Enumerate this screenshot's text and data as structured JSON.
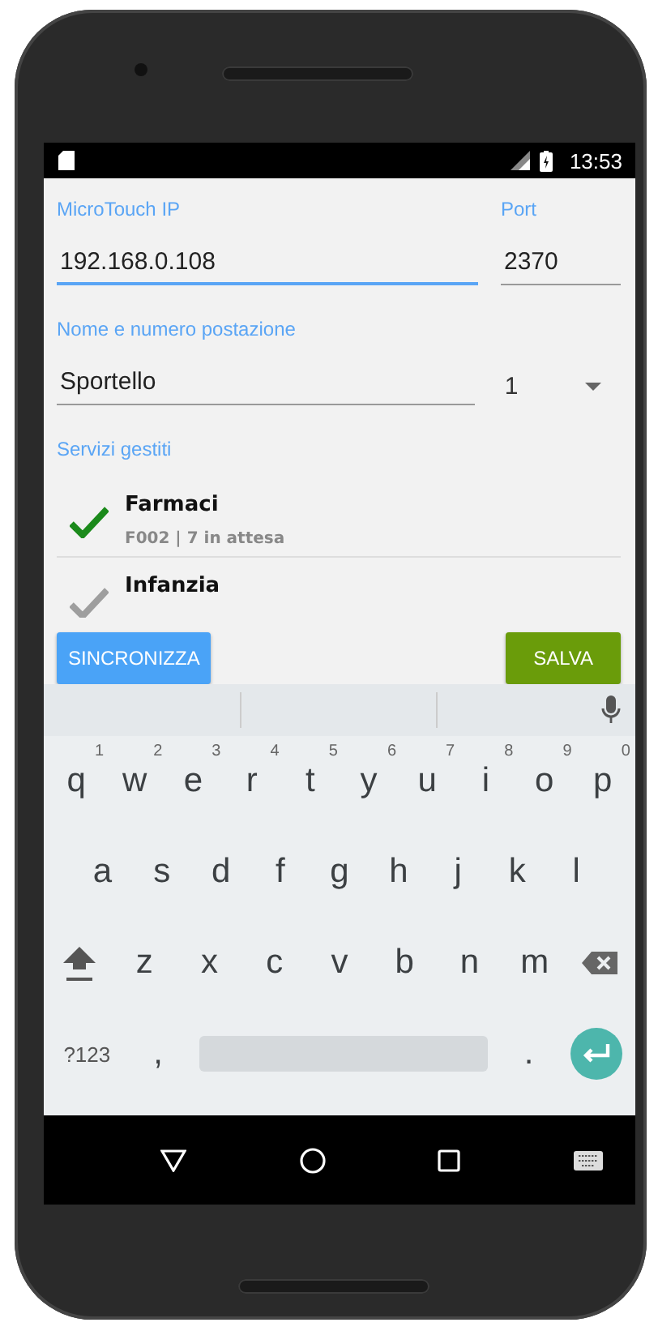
{
  "status_bar": {
    "time": "13:53"
  },
  "fields": {
    "ip_label": "MicroTouch IP",
    "port_label": "Port",
    "ip": "192.168.0.108",
    "port": "2370",
    "station_label": "Nome e numero postazione",
    "station_name": "Sportello",
    "station_number": "1"
  },
  "services_label": "Servizi gestiti",
  "services": [
    {
      "name": "Farmaci",
      "detail": "F002 | 7 in attesa",
      "checked": true
    },
    {
      "name": "Infanzia",
      "checked": false
    }
  ],
  "buttons": {
    "sync": "SINCRONIZZA",
    "save": "SALVA"
  },
  "keyboard": {
    "rows": [
      [
        {
          "label": "q",
          "hint": "1"
        },
        {
          "label": "w",
          "hint": "2"
        },
        {
          "label": "e",
          "hint": "3"
        },
        {
          "label": "r",
          "hint": "4"
        },
        {
          "label": "t",
          "hint": "5"
        },
        {
          "label": "y",
          "hint": "6"
        },
        {
          "label": "u",
          "hint": "7"
        },
        {
          "label": "i",
          "hint": "8"
        },
        {
          "label": "o",
          "hint": "9"
        },
        {
          "label": "p",
          "hint": "0"
        }
      ],
      [
        {
          "label": "a"
        },
        {
          "label": "s"
        },
        {
          "label": "d"
        },
        {
          "label": "f"
        },
        {
          "label": "g"
        },
        {
          "label": "h"
        },
        {
          "label": "j"
        },
        {
          "label": "k"
        },
        {
          "label": "l"
        }
      ],
      [
        {
          "kind": "shift"
        },
        {
          "label": "z"
        },
        {
          "label": "x"
        },
        {
          "label": "c"
        },
        {
          "label": "v"
        },
        {
          "label": "b"
        },
        {
          "label": "n"
        },
        {
          "label": "m"
        },
        {
          "kind": "backspace"
        }
      ],
      [
        {
          "kind": "symbols",
          "label": "?123"
        },
        {
          "label": ","
        },
        {
          "kind": "space"
        },
        {
          "label": "."
        },
        {
          "kind": "enter"
        }
      ]
    ]
  }
}
